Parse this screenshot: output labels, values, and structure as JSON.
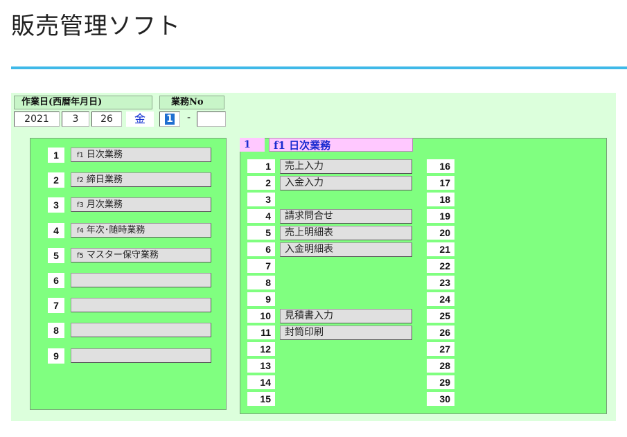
{
  "app": {
    "title": "販売管理ソフト"
  },
  "header": {
    "workdate_label": "作業日(西暦年月日)",
    "jobno_label": "業務No",
    "year": "2021",
    "month": "3",
    "day": "26",
    "weekday": "金",
    "job_no": "1",
    "dash": "-",
    "sub_no": ""
  },
  "main_menu": [
    {
      "num": "1",
      "fkey": "f1",
      "label": "日次業務"
    },
    {
      "num": "2",
      "fkey": "f2",
      "label": "締日業務"
    },
    {
      "num": "3",
      "fkey": "f3",
      "label": "月次業務"
    },
    {
      "num": "4",
      "fkey": "f4",
      "label": "年次･随時業務"
    },
    {
      "num": "5",
      "fkey": "f5",
      "label": "マスター保守業務"
    },
    {
      "num": "6",
      "fkey": "",
      "label": ""
    },
    {
      "num": "7",
      "fkey": "",
      "label": ""
    },
    {
      "num": "8",
      "fkey": "",
      "label": ""
    },
    {
      "num": "9",
      "fkey": "",
      "label": ""
    }
  ],
  "sub_panel": {
    "current_num": "1",
    "current_title": "f1  日次業務",
    "items": [
      {
        "num": "1",
        "label": "売上入力"
      },
      {
        "num": "2",
        "label": "入金入力"
      },
      {
        "num": "3",
        "label": ""
      },
      {
        "num": "4",
        "label": "請求問合せ"
      },
      {
        "num": "5",
        "label": "売上明細表"
      },
      {
        "num": "6",
        "label": "入金明細表"
      },
      {
        "num": "7",
        "label": ""
      },
      {
        "num": "8",
        "label": ""
      },
      {
        "num": "9",
        "label": ""
      },
      {
        "num": "10",
        "label": "見積書入力"
      },
      {
        "num": "11",
        "label": "封筒印刷"
      },
      {
        "num": "12",
        "label": ""
      },
      {
        "num": "13",
        "label": ""
      },
      {
        "num": "14",
        "label": ""
      },
      {
        "num": "15",
        "label": ""
      }
    ],
    "right_nums": [
      "16",
      "17",
      "18",
      "19",
      "20",
      "21",
      "22",
      "23",
      "24",
      "25",
      "26",
      "27",
      "28",
      "29",
      "30"
    ]
  }
}
